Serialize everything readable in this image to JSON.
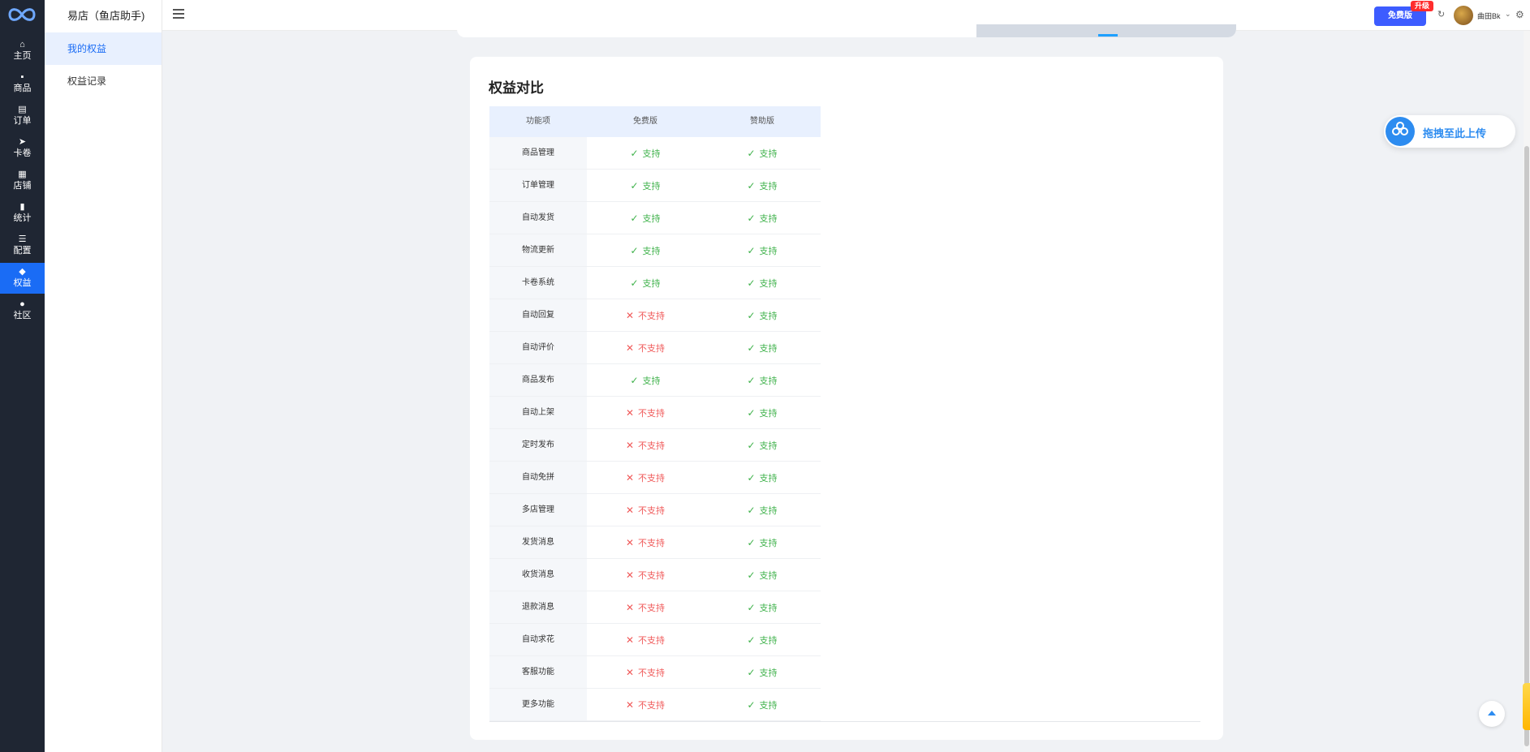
{
  "rail": {
    "items": [
      {
        "label": "主页",
        "icon": "⌂"
      },
      {
        "label": "商品",
        "icon": "▪"
      },
      {
        "label": "订单",
        "icon": "▤"
      },
      {
        "label": "卡卷",
        "icon": "➤"
      },
      {
        "label": "店铺",
        "icon": "▦"
      },
      {
        "label": "统计",
        "icon": "▮"
      },
      {
        "label": "配置",
        "icon": "☰"
      },
      {
        "label": "权益",
        "icon": "◆"
      },
      {
        "label": "社区",
        "icon": "●"
      }
    ],
    "active_index": 7
  },
  "subnav": {
    "title": "易店（鱼店助手)",
    "items": [
      {
        "label": "我的权益"
      },
      {
        "label": "权益记录"
      }
    ]
  },
  "topbar": {
    "free_button": "免费版",
    "upgrade_badge": "升级",
    "username": "曲田Bk"
  },
  "compare": {
    "title": "权益对比",
    "headers": [
      "功能项",
      "免费版",
      "赞助版"
    ],
    "rows": [
      {
        "feature": "商品管理",
        "free": "支持",
        "sponsor": "支持"
      },
      {
        "feature": "订单管理",
        "free": "支持",
        "sponsor": "支持"
      },
      {
        "feature": "自动发货",
        "free": "支持",
        "sponsor": "支持"
      },
      {
        "feature": "物流更新",
        "free": "支持",
        "sponsor": "支持"
      },
      {
        "feature": "卡卷系统",
        "free": "支持",
        "sponsor": "支持"
      },
      {
        "feature": "自动回复",
        "free": "不支持",
        "sponsor": "支持"
      },
      {
        "feature": "自动评价",
        "free": "不支持",
        "sponsor": "支持"
      },
      {
        "feature": "商品发布",
        "free": "支持",
        "sponsor": "支持"
      },
      {
        "feature": "自动上架",
        "free": "不支持",
        "sponsor": "支持"
      },
      {
        "feature": "定时发布",
        "free": "不支持",
        "sponsor": "支持"
      },
      {
        "feature": "自动免拼",
        "free": "不支持",
        "sponsor": "支持"
      },
      {
        "feature": "多店管理",
        "free": "不支持",
        "sponsor": "支持"
      },
      {
        "feature": "发货消息",
        "free": "不支持",
        "sponsor": "支持"
      },
      {
        "feature": "收货消息",
        "free": "不支持",
        "sponsor": "支持"
      },
      {
        "feature": "退款消息",
        "free": "不支持",
        "sponsor": "支持"
      },
      {
        "feature": "自动求花",
        "free": "不支持",
        "sponsor": "支持"
      },
      {
        "feature": "客服功能",
        "free": "不支持",
        "sponsor": "支持"
      },
      {
        "feature": "更多功能",
        "free": "不支持",
        "sponsor": "支持"
      }
    ]
  },
  "widgets": {
    "drag_upload_label": "拖拽至此上传"
  },
  "colors": {
    "rail_bg": "#1f2633",
    "accent": "#1a6cf5",
    "supported": "#3fb24b",
    "unsupported": "#f05a5a",
    "free_button": "#3d5cff",
    "upgrade_badge": "#ff2d2d"
  }
}
